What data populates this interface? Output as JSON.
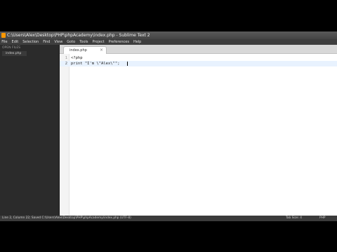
{
  "window": {
    "title": "C:\\Users\\Alex\\Desktop\\PHP\\phpAcademy\\index.php - Sublime Text 2"
  },
  "menubar": {
    "items": [
      "File",
      "Edit",
      "Selection",
      "Find",
      "View",
      "Goto",
      "Tools",
      "Project",
      "Preferences",
      "Help"
    ]
  },
  "sidebar": {
    "section_label": "OPEN FILES",
    "files": [
      "index.php"
    ]
  },
  "tabs": [
    {
      "label": "index.php",
      "close": "×"
    }
  ],
  "editor": {
    "lines": [
      {
        "number": "1",
        "code": "<?php"
      },
      {
        "number": "2",
        "code": "print \"I'm \\\"Alex\\\"\";"
      }
    ],
    "current_line": 2
  },
  "statusbar": {
    "left_text": "Line 2, Column 22; Saved C:\\Users\\Alex\\Desktop\\PHP\\phpAcademy\\index.php (UTF-8)",
    "tab_size": "Tab Size: 4",
    "syntax": "PHP"
  },
  "colors": {
    "accent": "#ff9800",
    "current_line_highlight": "#e8f2fe"
  }
}
